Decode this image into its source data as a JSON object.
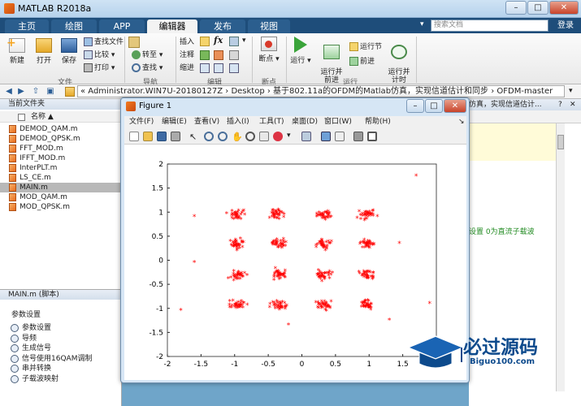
{
  "window": {
    "title": "MATLAB R2018a",
    "min": "–",
    "max": "□",
    "close": "✕"
  },
  "tabs": [
    "主页",
    "绘图",
    "APP",
    "编辑器",
    "发布",
    "视图"
  ],
  "search": {
    "placeholder": "搜索文档",
    "login": "登录"
  },
  "ribbon": {
    "file": {
      "new": "新建",
      "open": "打开",
      "save": "保存",
      "find_files": "查找文件",
      "compare": "比较",
      "print": "打印",
      "label": "文件"
    },
    "nav": {
      "goto": "转至",
      "find": "查找",
      "label": "导航"
    },
    "edit": {
      "insert": "插入",
      "comment": "注释",
      "indent": "缩进",
      "fx": "fx",
      "label": "编辑"
    },
    "breakpoint": {
      "bp": "断点",
      "label": "断点"
    },
    "run": {
      "run": "运行",
      "run_advance": "运行并\n前进",
      "run_section": "运行节",
      "advance": "前进",
      "run_time": "运行并\n计时",
      "label": "运行"
    }
  },
  "address": {
    "path": "« Administrator.WIN7U-20180127Z  ›  Desktop  ›  基于802.11a的OFDM的Matlab仿真，实现信道估计和同步  ›  OFDM-master"
  },
  "left_panel": {
    "header": "当前文件夹",
    "name_col": "名称 ▲",
    "files": [
      "DEMOD_QAM.m",
      "DEMOD_QPSK.m",
      "FFT_MOD.m",
      "IFFT_MOD.m",
      "InterPLT.m",
      "LS_CE.m",
      "MAIN.m",
      "MOD_QAM.m",
      "MOD_QPSK.m"
    ],
    "selected_index": 6,
    "detail_header": "MAIN.m  (脚本)",
    "detail_title": "参数设置",
    "detail_items": [
      "参数设置",
      "导频",
      "生成信号",
      "信号使用16QAM调制",
      "串并转换",
      "子载波映射"
    ]
  },
  "editor": {
    "title": "仿真，实现信道估计...",
    "comment": "设置  0为直流子载波"
  },
  "figure": {
    "title": "Figure 1",
    "menus": [
      "文件(F)",
      "编辑(E)",
      "查看(V)",
      "插入(I)",
      "工具(T)",
      "桌面(D)",
      "窗口(W)",
      "帮助(H)"
    ]
  },
  "chart_data": {
    "type": "scatter",
    "marker": "*",
    "color": "#ff0000",
    "xlim": [
      -2,
      2
    ],
    "ylim": [
      -2,
      2
    ],
    "xticks": [
      "-2",
      "-1.5",
      "-1",
      "-0.5",
      "0",
      "0.5",
      "1",
      "1.5",
      "2"
    ],
    "yticks": [
      "2",
      "1.5",
      "1",
      "0.5",
      "0",
      "-0.5",
      "-1",
      "-1.5",
      "-2"
    ],
    "xtick_values": [
      -2,
      -1.5,
      -1,
      -0.5,
      0,
      0.5,
      1,
      1.5,
      2
    ],
    "ytick_values": [
      2,
      1.5,
      1,
      0.5,
      0,
      -0.5,
      -1,
      -1.5,
      -2
    ],
    "clusters": [
      {
        "x": -0.95,
        "y": 0.93
      },
      {
        "x": -0.35,
        "y": 0.95
      },
      {
        "x": 0.33,
        "y": 0.93
      },
      {
        "x": 0.98,
        "y": 0.92
      },
      {
        "x": -0.95,
        "y": 0.33
      },
      {
        "x": -0.33,
        "y": 0.32
      },
      {
        "x": 0.32,
        "y": 0.33
      },
      {
        "x": 0.97,
        "y": 0.32
      },
      {
        "x": -0.95,
        "y": -0.33
      },
      {
        "x": -0.33,
        "y": -0.32
      },
      {
        "x": 0.33,
        "y": -0.33
      },
      {
        "x": 0.97,
        "y": -0.32
      },
      {
        "x": -0.95,
        "y": -0.95
      },
      {
        "x": -0.33,
        "y": -0.95
      },
      {
        "x": 0.33,
        "y": -0.95
      },
      {
        "x": 0.97,
        "y": -0.93
      }
    ],
    "outliers": [
      [
        1.7,
        1.75
      ],
      [
        -1.8,
        -1.05
      ],
      [
        -1.6,
        0.9
      ],
      [
        -1.6,
        -0.05
      ],
      [
        1.9,
        -0.9
      ],
      [
        1.45,
        0.35
      ],
      [
        -0.2,
        -1.35
      ],
      [
        1.3,
        -1.25
      ]
    ]
  },
  "watermark": {
    "text": "必过源码",
    "sub": "Biguo100.com"
  }
}
